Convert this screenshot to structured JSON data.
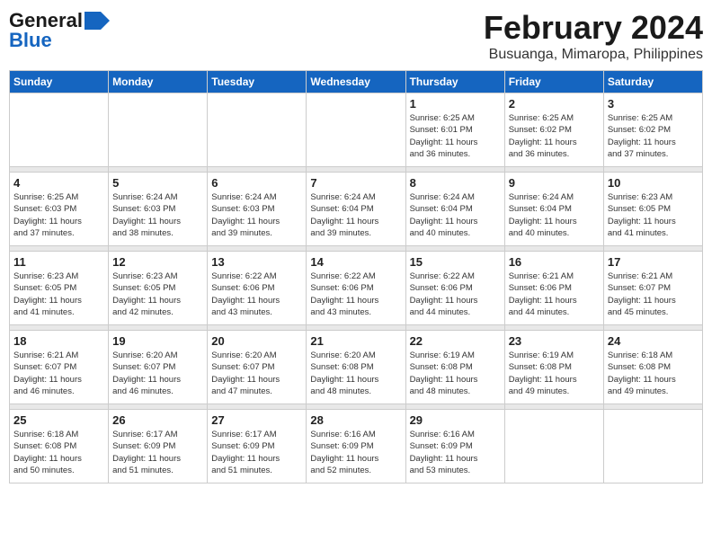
{
  "header": {
    "logo_line1": "General",
    "logo_line2": "Blue",
    "calendar_title": "February 2024",
    "calendar_subtitle": "Busuanga, Mimaropa, Philippines"
  },
  "days_of_week": [
    "Sunday",
    "Monday",
    "Tuesday",
    "Wednesday",
    "Thursday",
    "Friday",
    "Saturday"
  ],
  "weeks": [
    [
      {
        "day": "",
        "info": ""
      },
      {
        "day": "",
        "info": ""
      },
      {
        "day": "",
        "info": ""
      },
      {
        "day": "",
        "info": ""
      },
      {
        "day": "1",
        "info": "Sunrise: 6:25 AM\nSunset: 6:01 PM\nDaylight: 11 hours\nand 36 minutes."
      },
      {
        "day": "2",
        "info": "Sunrise: 6:25 AM\nSunset: 6:02 PM\nDaylight: 11 hours\nand 36 minutes."
      },
      {
        "day": "3",
        "info": "Sunrise: 6:25 AM\nSunset: 6:02 PM\nDaylight: 11 hours\nand 37 minutes."
      }
    ],
    [
      {
        "day": "4",
        "info": "Sunrise: 6:25 AM\nSunset: 6:03 PM\nDaylight: 11 hours\nand 37 minutes."
      },
      {
        "day": "5",
        "info": "Sunrise: 6:24 AM\nSunset: 6:03 PM\nDaylight: 11 hours\nand 38 minutes."
      },
      {
        "day": "6",
        "info": "Sunrise: 6:24 AM\nSunset: 6:03 PM\nDaylight: 11 hours\nand 39 minutes."
      },
      {
        "day": "7",
        "info": "Sunrise: 6:24 AM\nSunset: 6:04 PM\nDaylight: 11 hours\nand 39 minutes."
      },
      {
        "day": "8",
        "info": "Sunrise: 6:24 AM\nSunset: 6:04 PM\nDaylight: 11 hours\nand 40 minutes."
      },
      {
        "day": "9",
        "info": "Sunrise: 6:24 AM\nSunset: 6:04 PM\nDaylight: 11 hours\nand 40 minutes."
      },
      {
        "day": "10",
        "info": "Sunrise: 6:23 AM\nSunset: 6:05 PM\nDaylight: 11 hours\nand 41 minutes."
      }
    ],
    [
      {
        "day": "11",
        "info": "Sunrise: 6:23 AM\nSunset: 6:05 PM\nDaylight: 11 hours\nand 41 minutes."
      },
      {
        "day": "12",
        "info": "Sunrise: 6:23 AM\nSunset: 6:05 PM\nDaylight: 11 hours\nand 42 minutes."
      },
      {
        "day": "13",
        "info": "Sunrise: 6:22 AM\nSunset: 6:06 PM\nDaylight: 11 hours\nand 43 minutes."
      },
      {
        "day": "14",
        "info": "Sunrise: 6:22 AM\nSunset: 6:06 PM\nDaylight: 11 hours\nand 43 minutes."
      },
      {
        "day": "15",
        "info": "Sunrise: 6:22 AM\nSunset: 6:06 PM\nDaylight: 11 hours\nand 44 minutes."
      },
      {
        "day": "16",
        "info": "Sunrise: 6:21 AM\nSunset: 6:06 PM\nDaylight: 11 hours\nand 44 minutes."
      },
      {
        "day": "17",
        "info": "Sunrise: 6:21 AM\nSunset: 6:07 PM\nDaylight: 11 hours\nand 45 minutes."
      }
    ],
    [
      {
        "day": "18",
        "info": "Sunrise: 6:21 AM\nSunset: 6:07 PM\nDaylight: 11 hours\nand 46 minutes."
      },
      {
        "day": "19",
        "info": "Sunrise: 6:20 AM\nSunset: 6:07 PM\nDaylight: 11 hours\nand 46 minutes."
      },
      {
        "day": "20",
        "info": "Sunrise: 6:20 AM\nSunset: 6:07 PM\nDaylight: 11 hours\nand 47 minutes."
      },
      {
        "day": "21",
        "info": "Sunrise: 6:20 AM\nSunset: 6:08 PM\nDaylight: 11 hours\nand 48 minutes."
      },
      {
        "day": "22",
        "info": "Sunrise: 6:19 AM\nSunset: 6:08 PM\nDaylight: 11 hours\nand 48 minutes."
      },
      {
        "day": "23",
        "info": "Sunrise: 6:19 AM\nSunset: 6:08 PM\nDaylight: 11 hours\nand 49 minutes."
      },
      {
        "day": "24",
        "info": "Sunrise: 6:18 AM\nSunset: 6:08 PM\nDaylight: 11 hours\nand 49 minutes."
      }
    ],
    [
      {
        "day": "25",
        "info": "Sunrise: 6:18 AM\nSunset: 6:08 PM\nDaylight: 11 hours\nand 50 minutes."
      },
      {
        "day": "26",
        "info": "Sunrise: 6:17 AM\nSunset: 6:09 PM\nDaylight: 11 hours\nand 51 minutes."
      },
      {
        "day": "27",
        "info": "Sunrise: 6:17 AM\nSunset: 6:09 PM\nDaylight: 11 hours\nand 51 minutes."
      },
      {
        "day": "28",
        "info": "Sunrise: 6:16 AM\nSunset: 6:09 PM\nDaylight: 11 hours\nand 52 minutes."
      },
      {
        "day": "29",
        "info": "Sunrise: 6:16 AM\nSunset: 6:09 PM\nDaylight: 11 hours\nand 53 minutes."
      },
      {
        "day": "",
        "info": ""
      },
      {
        "day": "",
        "info": ""
      }
    ]
  ]
}
